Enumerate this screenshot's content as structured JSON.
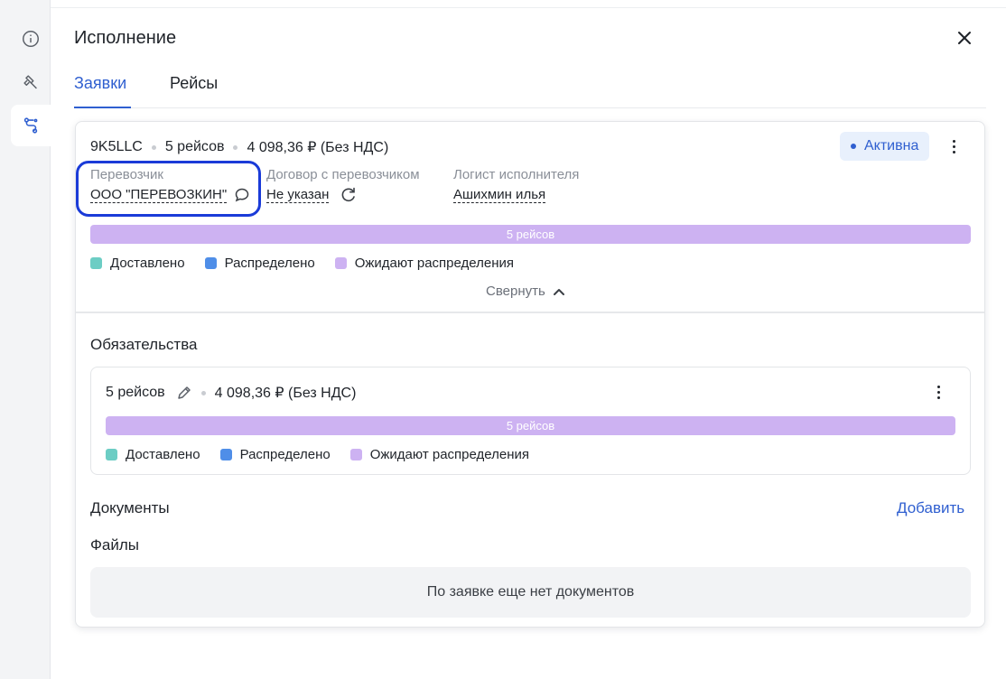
{
  "sidebar": {
    "items": [
      {
        "icon": "info-icon",
        "active": false
      },
      {
        "icon": "gavel-icon",
        "active": false
      },
      {
        "icon": "route-icon",
        "active": true
      }
    ]
  },
  "panel": {
    "title": "Исполнение",
    "close_icon": "close-icon"
  },
  "tabs": [
    {
      "label": "Заявки",
      "active": true
    },
    {
      "label": "Рейсы",
      "active": false
    }
  ],
  "order": {
    "code": "9K5LLC",
    "trips": "5 рейсов",
    "amount": "4 098,36 ₽ (Без НДС)",
    "status": "Активна",
    "carrier_label": "Перевозчик",
    "carrier_value": "ООО \"ПЕРЕВОЗКИН\"",
    "contract_label": "Договор с перевозчиком",
    "contract_value": "Не указан",
    "logist_label": "Логист исполнителя",
    "logist_value": "Ашихмин илья",
    "bar_label": "5 рейсов",
    "collapse_label": "Свернуть"
  },
  "legend": {
    "delivered": "Доставлено",
    "distributed": "Распределено",
    "awaiting": "Ожидают распределения"
  },
  "colors": {
    "accent": "#2f5fd0",
    "delivered": "#6ccdc4",
    "distributed": "#4f8ee8",
    "awaiting": "#cdb2f2",
    "highlight": "#1a3bd8"
  },
  "progress": {
    "delivered_fraction": 0,
    "distributed_fraction": 0,
    "awaiting_fraction": 1
  },
  "obligations": {
    "title": "Обязательства",
    "trips": "5 рейсов",
    "amount": "4 098,36 ₽ (Без НДС)",
    "bar_label": "5 рейсов"
  },
  "documents": {
    "title": "Документы",
    "add_label": "Добавить",
    "files_label": "Файлы",
    "empty_text": "По заявке еще нет документов"
  }
}
